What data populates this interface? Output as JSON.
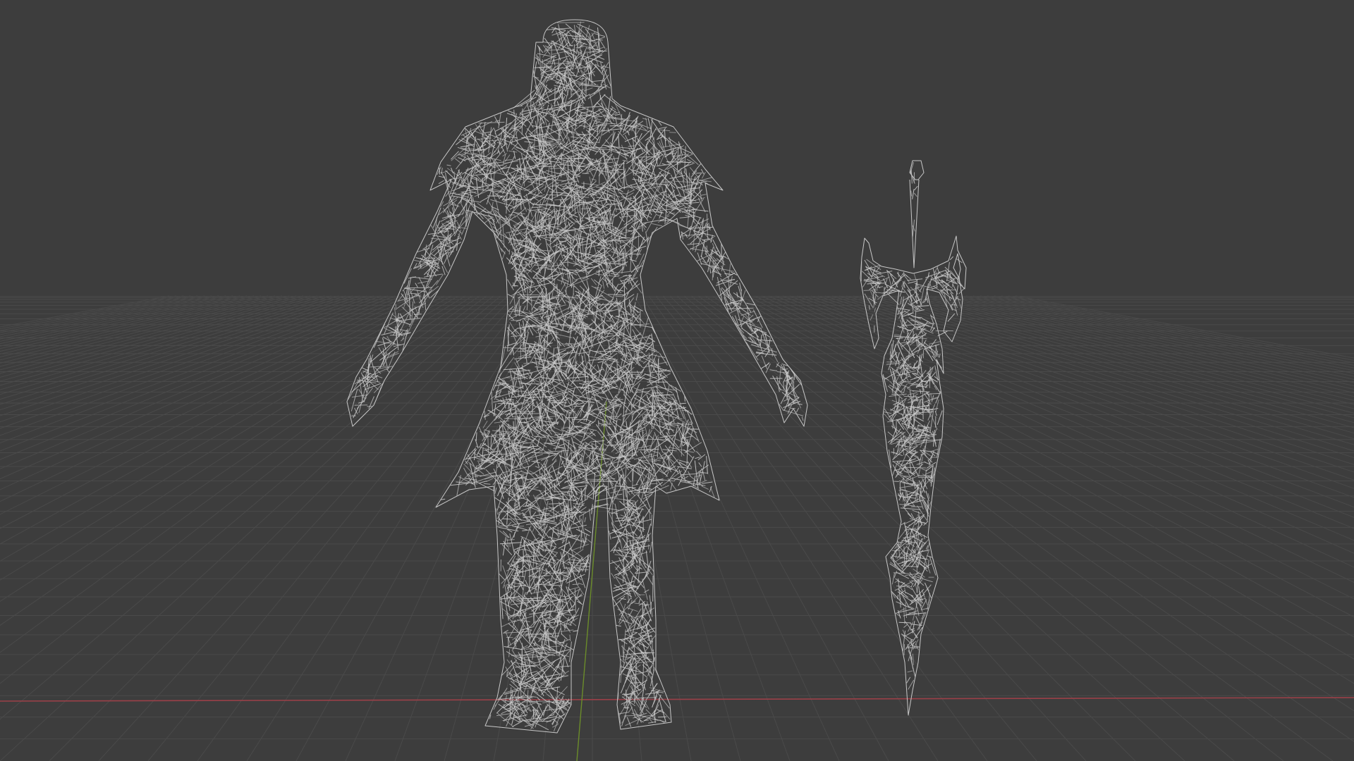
{
  "viewport": {
    "background": "#3d3d3d",
    "grid_color": "#4a4a4a",
    "x_axis_color": "#9b4048",
    "y_axis_color": "#6b8c2a",
    "wire_color": "#c8c8c8",
    "view_mode": "wireframe"
  },
  "objects": [
    {
      "name": "character-mesh",
      "icon": "armored-warrior"
    },
    {
      "name": "sword-mesh",
      "icon": "ornate-sword"
    }
  ]
}
